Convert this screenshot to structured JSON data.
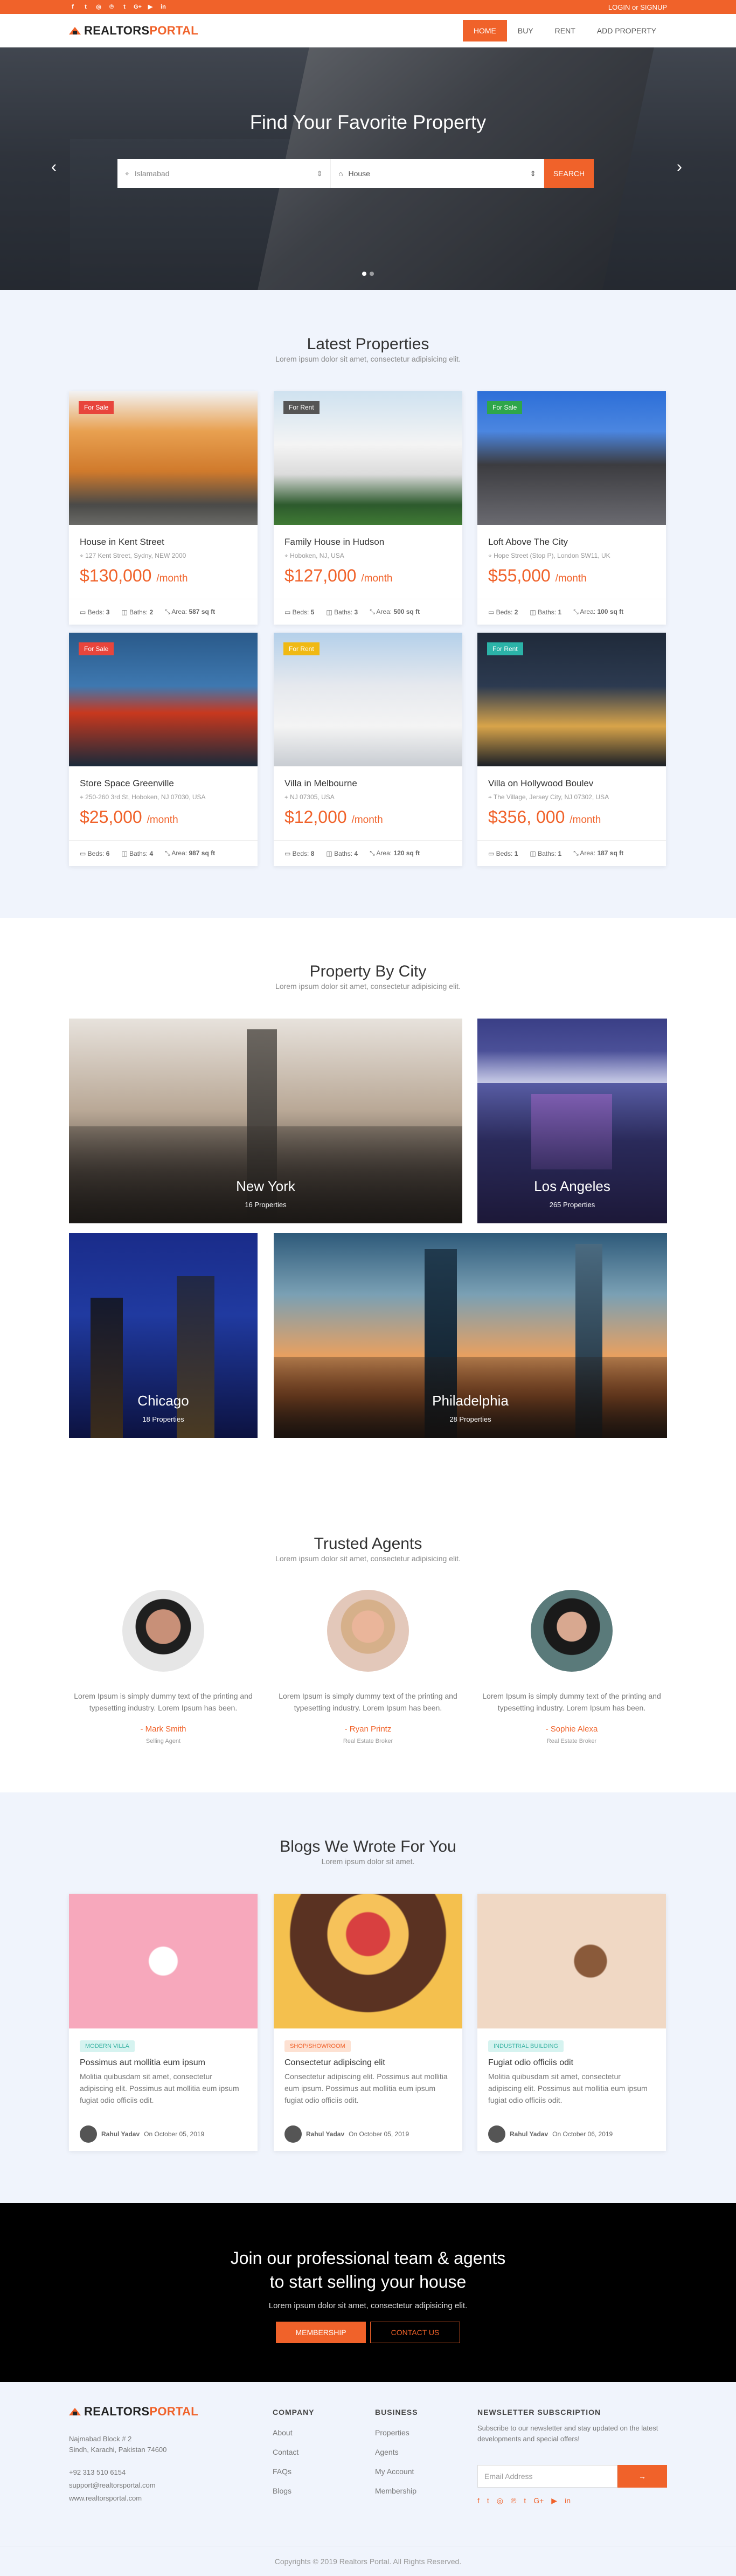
{
  "topbar": {
    "socials": [
      "f",
      "t",
      "i",
      "p",
      "t",
      "G+",
      "yt",
      "in"
    ],
    "login": "LOGIN or SIGNUP"
  },
  "brand": {
    "part1": "REALTORS",
    "part2": "PORTAL"
  },
  "nav": [
    "HOME",
    "BUY",
    "RENT",
    "ADD PROPERTY"
  ],
  "hero": {
    "title": "Find Your Favorite Property",
    "location": "Islamabad",
    "type": "House",
    "search": "SEARCH",
    "prev": "‹",
    "next": "›"
  },
  "latest": {
    "title": "Latest Properties",
    "sub": "Lorem ipsum dolor sit amet, consectetur adipisicing elit.",
    "cards": [
      {
        "badge": "For Sale",
        "title": "House in Kent Street",
        "addr": "127 Kent Street, Sydny, NEW 2000",
        "price": "$130,000",
        "per": "/month",
        "beds": "3",
        "baths": "2",
        "area": "587 sq ft"
      },
      {
        "badge": "For Rent",
        "title": "Family House in Hudson",
        "addr": "Hoboken, NJ, USA",
        "price": "$127,000",
        "per": "/month",
        "beds": "5",
        "baths": "3",
        "area": "500 sq ft"
      },
      {
        "badge": "For Sale",
        "title": "Loft Above The City",
        "addr": "Hope Street (Stop P), London SW11, UK",
        "price": "$55,000",
        "per": "/month",
        "beds": "2",
        "baths": "1",
        "area": "100 sq ft"
      },
      {
        "badge": "For Sale",
        "title": "Store Space Greenville",
        "addr": "250-260 3rd St, Hoboken, NJ 07030, USA",
        "price": "$25,000",
        "per": "/month",
        "beds": "6",
        "baths": "4",
        "area": "987 sq ft"
      },
      {
        "badge": "For Rent",
        "title": "Villa in Melbourne",
        "addr": "NJ 07305, USA",
        "price": "$12,000",
        "per": "/month",
        "beds": "8",
        "baths": "4",
        "area": "120 sq ft"
      },
      {
        "badge": "For Rent",
        "title": "Villa on Hollywood Boulev",
        "addr": "The Village, Jersey City, NJ 07302, USA",
        "price": "$356, 000",
        "per": "/month",
        "beds": "1",
        "baths": "1",
        "area": "187 sq ft"
      }
    ],
    "labels": {
      "beds": "Beds:",
      "baths": "Baths:",
      "area": "Area:"
    }
  },
  "cities": {
    "title": "Property By City",
    "sub": "Lorem ipsum dolor sit amet, consectetur adipisicing elit.",
    "items": [
      {
        "name": "New York",
        "count": "16 Properties"
      },
      {
        "name": "Los Angeles",
        "count": "265 Properties"
      },
      {
        "name": "Chicago",
        "count": "18 Properties"
      },
      {
        "name": "Philadelphia",
        "count": "28 Properties"
      }
    ]
  },
  "agents": {
    "title": "Trusted Agents",
    "sub": "Lorem ipsum dolor sit amet, consectetur adipisicing elit.",
    "items": [
      {
        "text": "Lorem Ipsum is simply dummy text of the printing and typesetting industry. Lorem Ipsum has been.",
        "name": "- Mark Smith",
        "role": "Selling Agent"
      },
      {
        "text": "Lorem Ipsum is simply dummy text of the printing and typesetting industry. Lorem Ipsum has been.",
        "name": "- Ryan Printz",
        "role": "Real Estate Broker"
      },
      {
        "text": "Lorem Ipsum is simply dummy text of the printing and typesetting industry. Lorem Ipsum has been.",
        "name": "- Sophie Alexa",
        "role": "Real Estate Broker"
      }
    ]
  },
  "blogs": {
    "title": "Blogs We Wrote For You",
    "sub": "Lorem ipsum dolor sit amet.",
    "items": [
      {
        "tag": "MODERN VILLA",
        "title": "Possimus aut mollitia eum ipsum",
        "text": "Molitia quibusdam sit amet, consectetur adipiscing elit. Possimus aut mollitia eum ipsum fugiat odio officiis odit.",
        "author": "Rahul Yadav",
        "date": "On October 05, 2019"
      },
      {
        "tag": "SHOP/SHOWROOM",
        "title": "Consectetur adipiscing elit",
        "text": "Consectetur adipiscing elit. Possimus aut mollitia eum ipsum. Possimus aut mollitia eum ipsum fugiat odio officiis odit.",
        "author": "Rahul Yadav",
        "date": "On October 05, 2019"
      },
      {
        "tag": "INDUSTRIAL BUILDING",
        "title": "Fugiat odio officiis odit",
        "text": "Molitia quibusdam sit amet, consectetur adipiscing elit. Possimus aut mollitia eum ipsum fugiat odio officiis odit.",
        "author": "Rahul Yadav",
        "date": "On October 06, 2019"
      }
    ]
  },
  "cta": {
    "line1": "Join our professional team & agents",
    "line2": "to start selling your house",
    "sub": "Lorem ipsum dolor sit amet, consectetur adipisicing elit.",
    "membership": "MEMBERSHIP",
    "contact": "CONTACT US"
  },
  "footer": {
    "address": [
      "Najmabad Block # 2",
      "Sindh, Karachi, Pakistan 74600"
    ],
    "contact": [
      "+92 313 510 6154",
      "support@realtorsportal.com",
      "www.realtorsportal.com"
    ],
    "company": {
      "title": "COMPANY",
      "links": [
        "About",
        "Contact",
        "FAQs",
        "Blogs"
      ]
    },
    "business": {
      "title": "BUSINESS",
      "links": [
        "Properties",
        "Agents",
        "My Account",
        "Membership"
      ]
    },
    "newsletter": {
      "title": "NEWSLETTER SUBSCRIPTION",
      "text": "Subscribe to our newsletter and stay updated on the latest developments and special offers!",
      "placeholder": "Email Address",
      "button": "→"
    },
    "socials": [
      "f",
      "t",
      "ig",
      "p",
      "t",
      "G+",
      "yt",
      "in"
    ],
    "copyright": "Copyrights © 2019 Realtors Portal. All Rights Reserved."
  },
  "colors": {
    "accent": "#f0622a",
    "sale": "#e8453c",
    "rent": "#f0b913",
    "rent2": "#2bb3a8",
    "salegreen": "#2ea64a"
  }
}
